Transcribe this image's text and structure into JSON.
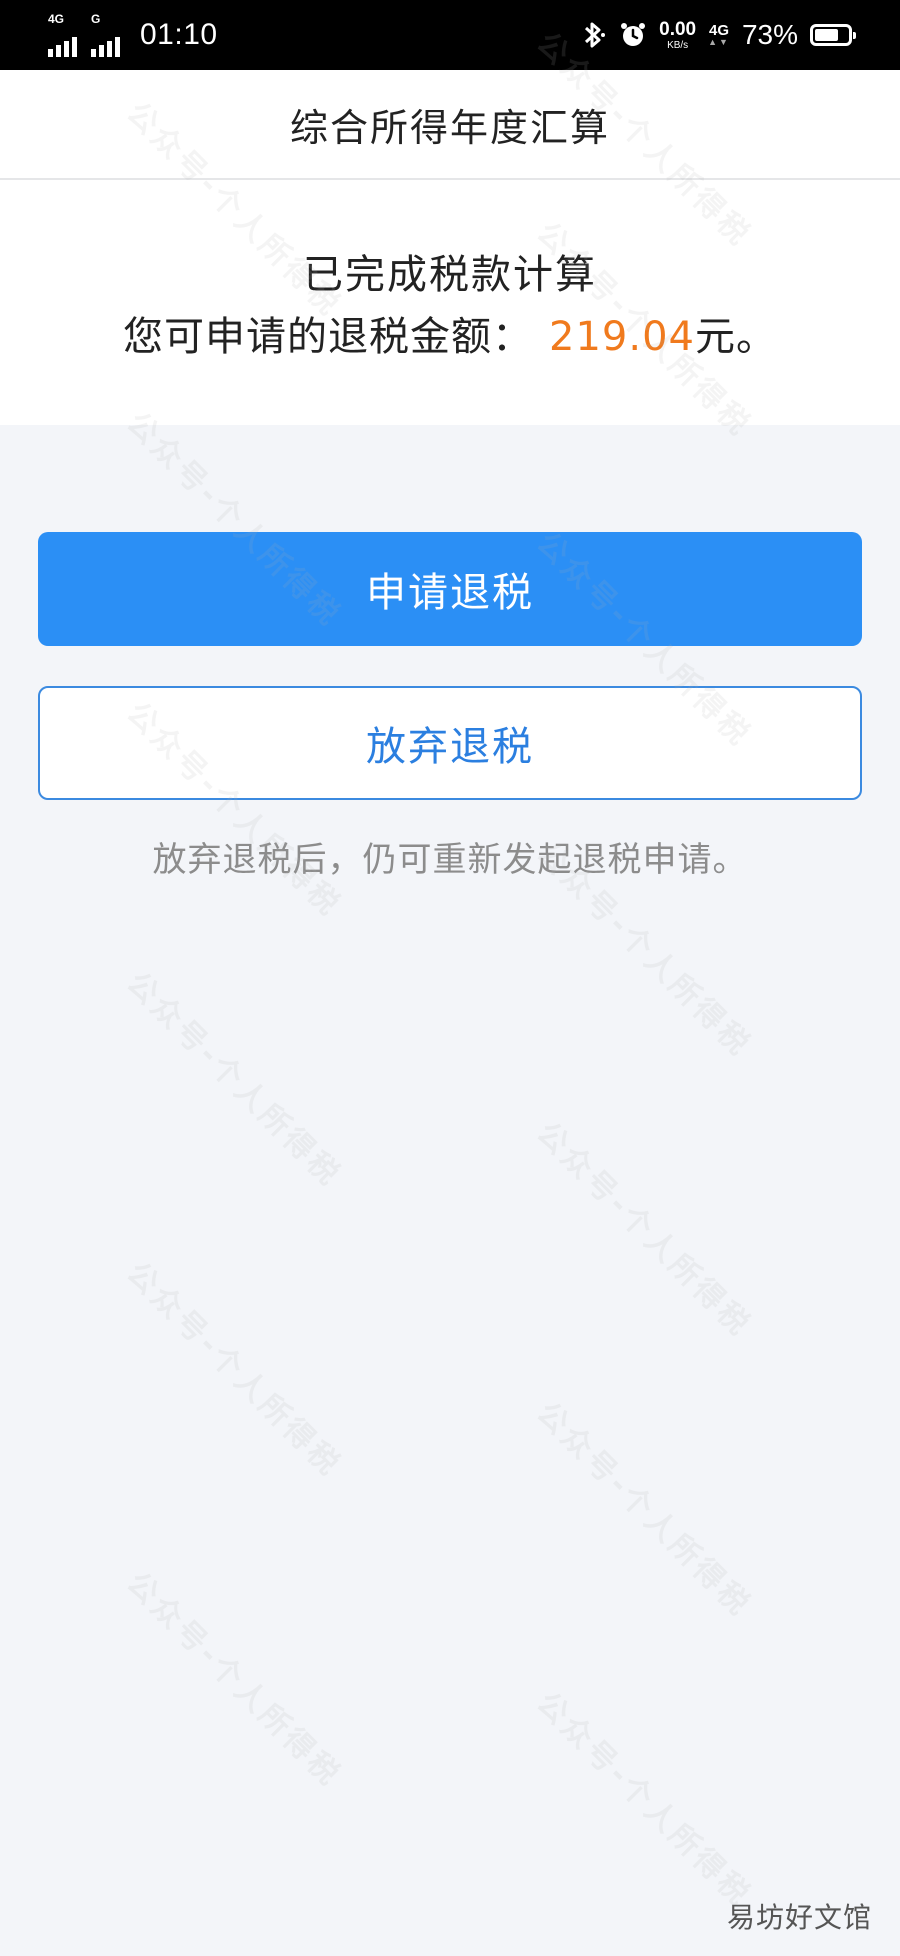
{
  "status_bar": {
    "sim1_tag": "4G",
    "sim2_tag": "G",
    "time": "01:10",
    "speed_value": "0.00",
    "speed_unit": "KB/s",
    "network": "4G",
    "battery": "73%",
    "battery_level": 0.73
  },
  "header": {
    "title": "综合所得年度汇算"
  },
  "result": {
    "line1": "已完成税款计算",
    "amount_label": "您可申请的退税金额：",
    "amount": "219.04",
    "amount_suffix": "元。",
    "amount_color": "#f07a1d"
  },
  "actions": {
    "apply_label": "申请退税",
    "abandon_label": "放弃退税",
    "hint": "放弃退税后，仍可重新发起退税申请。",
    "primary_color": "#2b8ff5"
  },
  "watermark": {
    "text": "公众号-个人所得税",
    "corner": "易坊好文馆"
  }
}
